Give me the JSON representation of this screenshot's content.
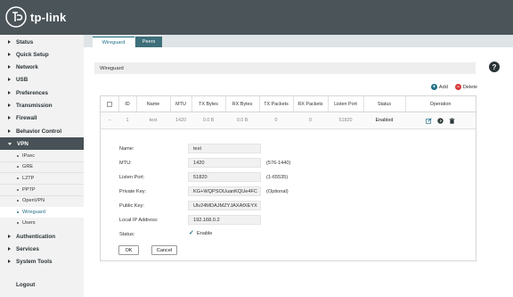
{
  "brand": {
    "logo_text": "tp-link"
  },
  "sidebar": {
    "items": [
      {
        "label": "Status"
      },
      {
        "label": "Quick Setup"
      },
      {
        "label": "Network"
      },
      {
        "label": "USB"
      },
      {
        "label": "Preferences"
      },
      {
        "label": "Transmission"
      },
      {
        "label": "Firewall"
      },
      {
        "label": "Behavior Control"
      },
      {
        "label": "VPN",
        "active": true
      },
      {
        "label": "Authentication"
      },
      {
        "label": "Services"
      },
      {
        "label": "System Tools"
      }
    ],
    "vpn_sub": [
      "IPsec",
      "GRE",
      "L2TP",
      "PPTP",
      "OpenVPN",
      "Wireguard",
      "Users"
    ],
    "logout": "Logout"
  },
  "tabs": {
    "wireguard": "Wireguard",
    "peers": "Peers"
  },
  "help": "?",
  "section_title": "Wireguard",
  "toolbar": {
    "add": "Add",
    "delete": "Delete"
  },
  "table": {
    "headers": [
      "ID",
      "Name",
      "MTU",
      "TX Bytes",
      "RX Bytes",
      "TX Packets",
      "RX Packets",
      "Listen Port",
      "Status",
      "Operation"
    ],
    "row": {
      "select": "--",
      "id": "1",
      "name": "test",
      "mtu": "1420",
      "tx_bytes": "0.0 B",
      "rx_bytes": "0.0 B",
      "tx_packets": "0",
      "rx_packets": "0",
      "listen_port": "51820",
      "status": "Enabled"
    }
  },
  "form": {
    "name_label": "Name:",
    "name": "test",
    "mtu_label": "MTU:",
    "mtu": "1420",
    "mtu_hint": "(576-1440)",
    "port_label": "Listen Port:",
    "port": "51820",
    "port_hint": "(1-65535)",
    "privkey_label": "Private Key:",
    "privkey": "KG+WQPSOUuanKQUe4FC",
    "privkey_hint": "(Optional)",
    "pubkey_label": "Public Key:",
    "pubkey": "Ulv24MDAJMZYJAXAfXEYX",
    "ip_label": "Local IP Address:",
    "ip": "192.168.0.2",
    "status_label": "Status:",
    "enable": "Enable",
    "ok": "OK",
    "cancel": "Cancel"
  },
  "colors": {
    "accent": "#1e6f86",
    "topbar": "#4a5459",
    "delete": "#d9383a"
  }
}
